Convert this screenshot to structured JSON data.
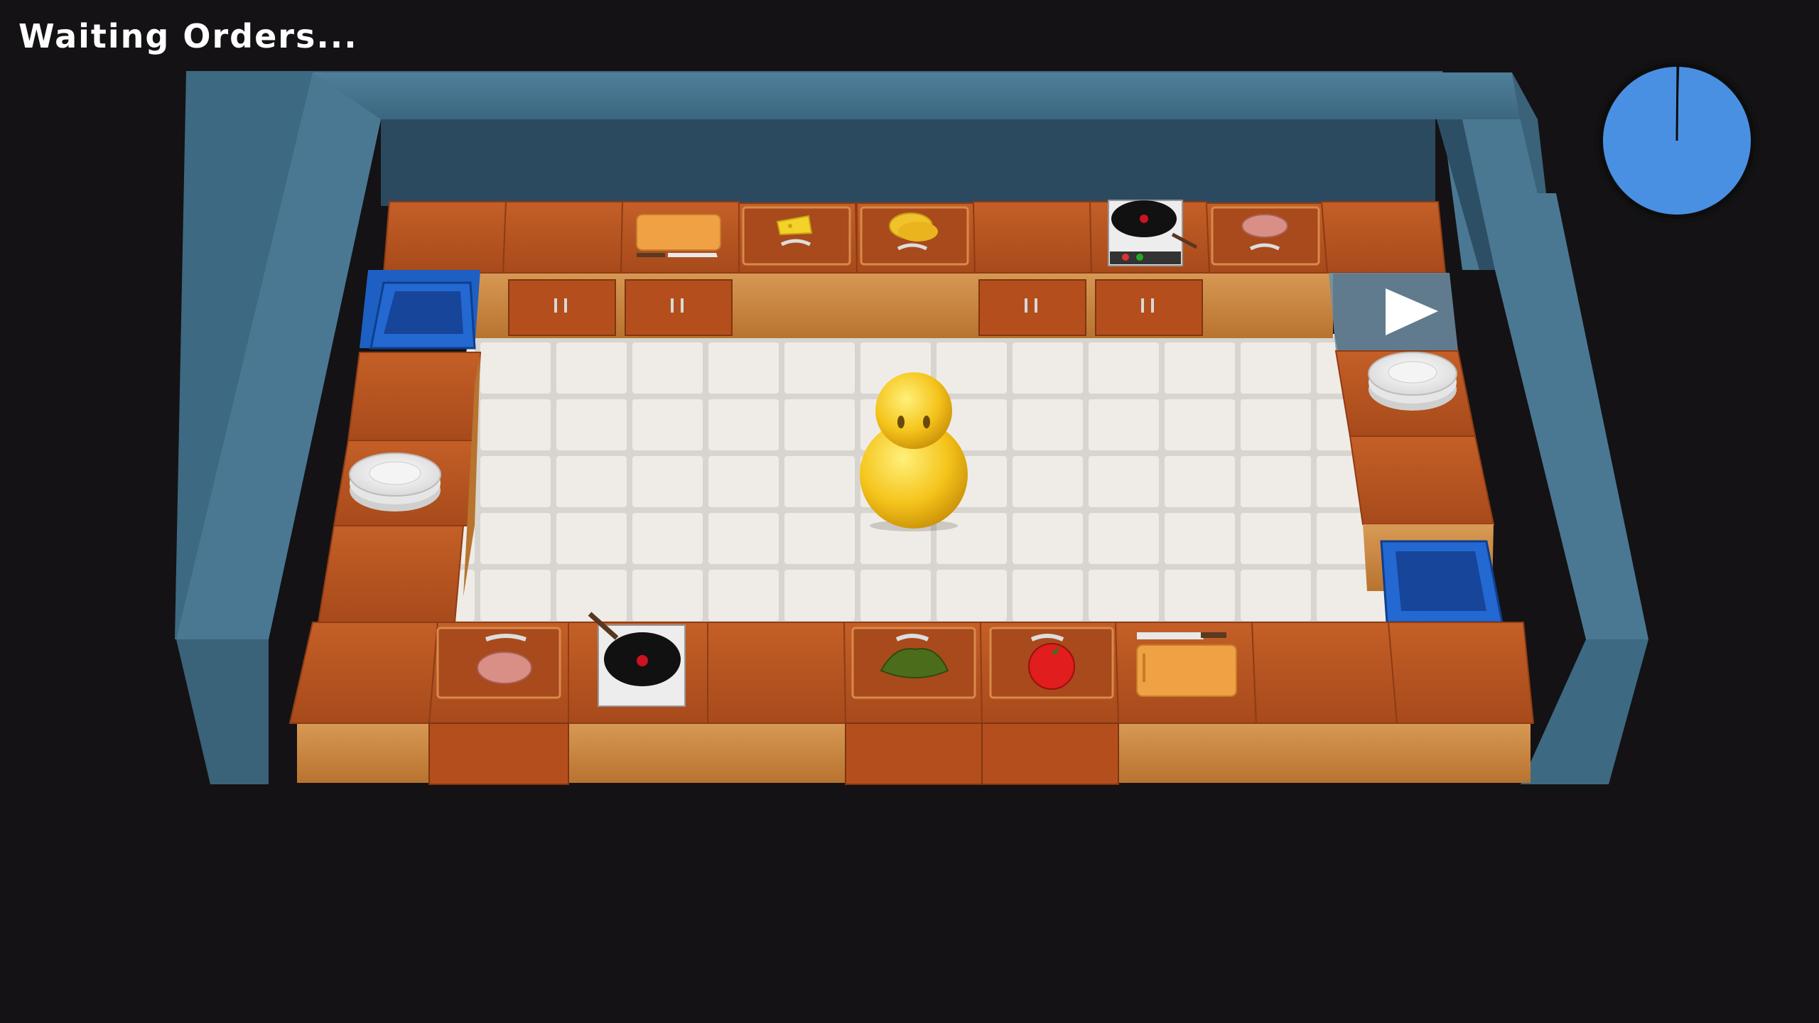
{
  "hud": {
    "status_text": "Waiting Orders...",
    "timer_icon": "round-timer-pie",
    "timer_fraction_remaining": 0.995
  },
  "colors": {
    "background": "#141214",
    "wall": "#4a7893",
    "counter_top": "#b5511f",
    "floor_tile": "#ece9e4",
    "timer_fill": "#4a90e2",
    "player": "#f7c51e",
    "bin": "#1f63c9"
  },
  "scene": {
    "player": {
      "name": "chef-character"
    },
    "back_row": [
      "counter",
      "counter",
      "cutting-board-station",
      "cheese-crate",
      "bun-crate",
      "counter",
      "stove-with-pan",
      "patty-crate",
      "serving-window"
    ],
    "front_row": [
      "counter",
      "patty-crate",
      "stove-with-pan",
      "counter",
      "lettuce-crate",
      "tomato-crate",
      "cutting-board-station",
      "counter",
      "counter"
    ],
    "left_column": [
      "trash-bin",
      "counter",
      "plate-stack",
      "counter"
    ],
    "right_column": [
      "plate-stack",
      "counter",
      "trash-bin"
    ]
  }
}
